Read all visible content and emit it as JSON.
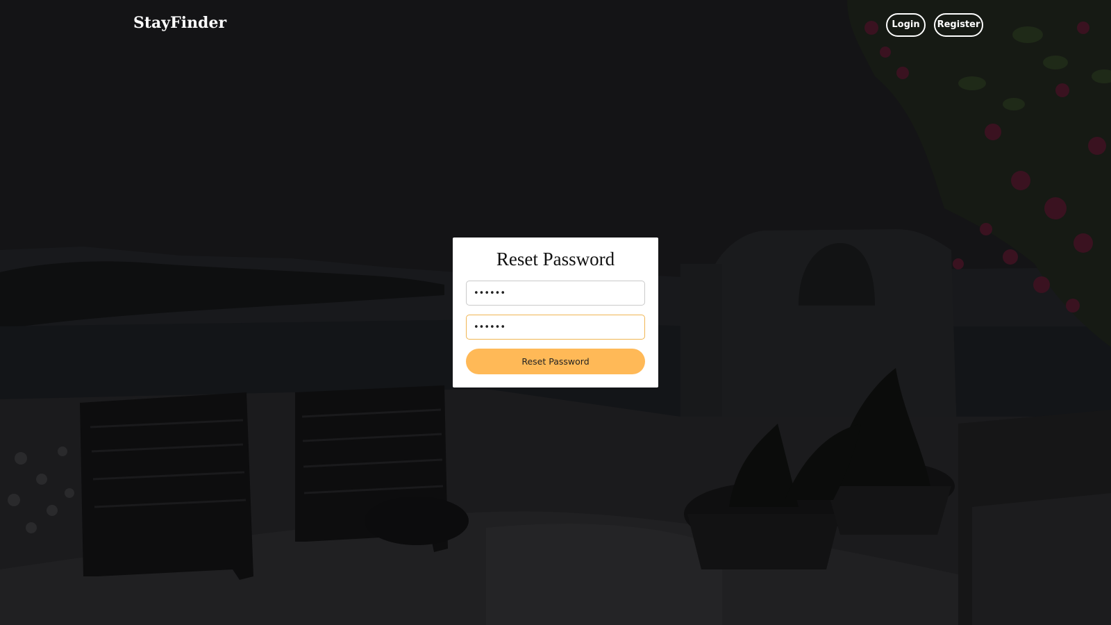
{
  "navbar": {
    "brand": "StayFinder",
    "login_label": "Login",
    "register_label": "Register"
  },
  "reset_form": {
    "title": "Reset Password",
    "new_password_value": "••••••",
    "confirm_password_value": "••••••",
    "submit_label": "Reset Password"
  },
  "colors": {
    "overlay": "#141416",
    "accent": "#ffb957",
    "focus_border": "#f0b552",
    "card": "#ffffff"
  }
}
